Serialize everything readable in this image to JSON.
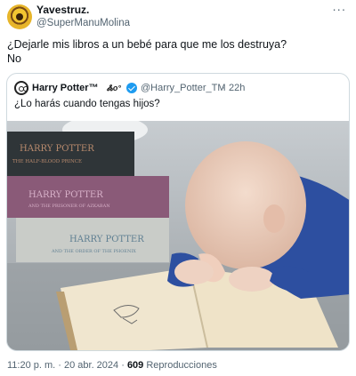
{
  "author": {
    "display_name": "Yavestruz.",
    "handle": "@SuperManuMolina"
  },
  "tweet": {
    "text_line1": "¿Dejarle mis libros a un bebé para que me los destruya?",
    "text_line2": "No"
  },
  "quoted": {
    "display_name": "Harry Potter™",
    "logo_text": "Ꮬo°",
    "handle": "@Harry_Potter_TM",
    "separator": "·",
    "time": "22h",
    "text": "¿Lo harás cuando tengas hijos?",
    "media": {
      "book_titles": [
        "HARRY POTTER",
        "THE HALF-BLOOD PRINCE",
        "HARRY POTTER",
        "AND THE PRISONER OF AZKABAN",
        "HARRY POTTER",
        "AND THE ORDER OF THE PHOENIX"
      ]
    }
  },
  "meta": {
    "timestamp": "11:20 p. m. · 20 abr. 2024 · ",
    "views_count": "609",
    "views_label": " Reproducciones"
  },
  "colors": {
    "verified_blue": "#1d9bf0",
    "secondary_text": "#536471",
    "border": "#cfd9de"
  },
  "icons": {
    "more": "more-icon",
    "verified": "verified-badge-icon"
  }
}
